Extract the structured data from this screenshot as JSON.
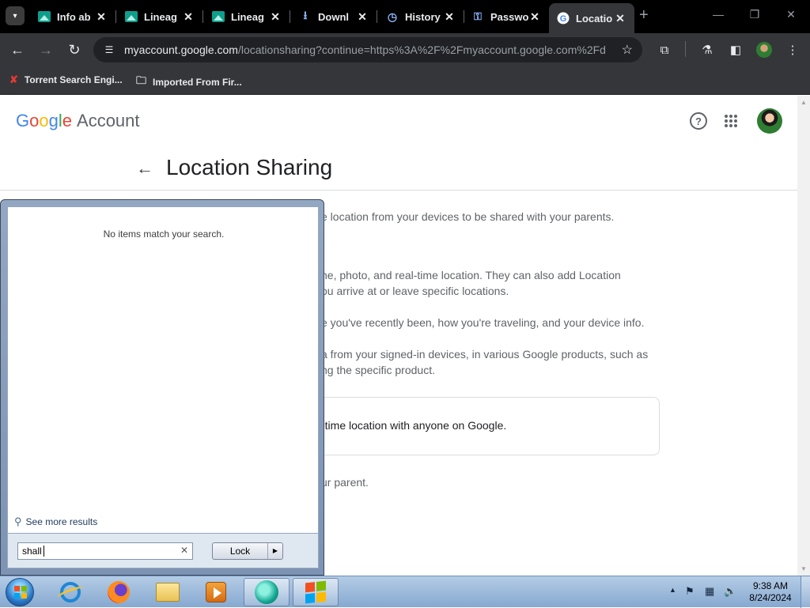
{
  "browser": {
    "tabs": [
      {
        "title": "Info ab",
        "favicon": "teal-landscape-icon",
        "active": false
      },
      {
        "title": "Lineag",
        "favicon": "teal-landscape-icon",
        "active": false
      },
      {
        "title": "Lineag",
        "favicon": "teal-landscape-icon",
        "active": false
      },
      {
        "title": "Downl",
        "favicon": "download-icon",
        "active": false
      },
      {
        "title": "History",
        "favicon": "history-icon",
        "active": false
      },
      {
        "title": "Passwo",
        "favicon": "key-icon",
        "active": false
      },
      {
        "title": "Locatio",
        "favicon": "google-g-icon",
        "active": true
      }
    ],
    "tab_close_glyph": "✕",
    "new_tab_glyph": "+",
    "address": {
      "host": "myaccount.google.com",
      "path": "/locationsharing?continue=https%3A%2F%2Fmyaccount.google.com%2Fd..."
    },
    "bookmarks": [
      {
        "label": "Torrent Search Engi...",
        "icon": "torrent-x-icon"
      },
      {
        "label": "Imported From Fir...",
        "icon": "folder-icon"
      }
    ]
  },
  "page": {
    "logo": {
      "g": "G",
      "o1": "o",
      "o2": "o",
      "g2": "g",
      "l": "l",
      "e": "e",
      "account": "Account"
    },
    "title": "Location Sharing",
    "paragraphs": [
      "e location from your devices to be shared with your parents.",
      "ne, photo, and real-time location. They can also add Location",
      "ou arrive at or leave specific locations.",
      "e you've recently been, how you're traveling, and your device info.",
      "a from your signed-in devices, in various Google products, such as",
      "ng the specific product."
    ],
    "card_text": "-time location with anyone on Google.",
    "footer_text": "ur parent."
  },
  "start_menu": {
    "no_items_text": "No items match your search.",
    "see_more_label": "See more results",
    "search_value": "shall",
    "clear_glyph": "✕",
    "shutdown_label": "Lock"
  },
  "taskbar": {
    "apps": [
      "internet-explorer-icon",
      "firefox-icon",
      "file-explorer-icon",
      "media-player-icon",
      "teal-app-icon",
      "windows-icon"
    ],
    "time": "9:38 AM",
    "date": "8/24/2024"
  },
  "colors": {
    "chrome_dark": "#35363a",
    "tab_strip": "#000000",
    "google_blue": "#4285f4",
    "taskbar": "#86a8d0"
  }
}
